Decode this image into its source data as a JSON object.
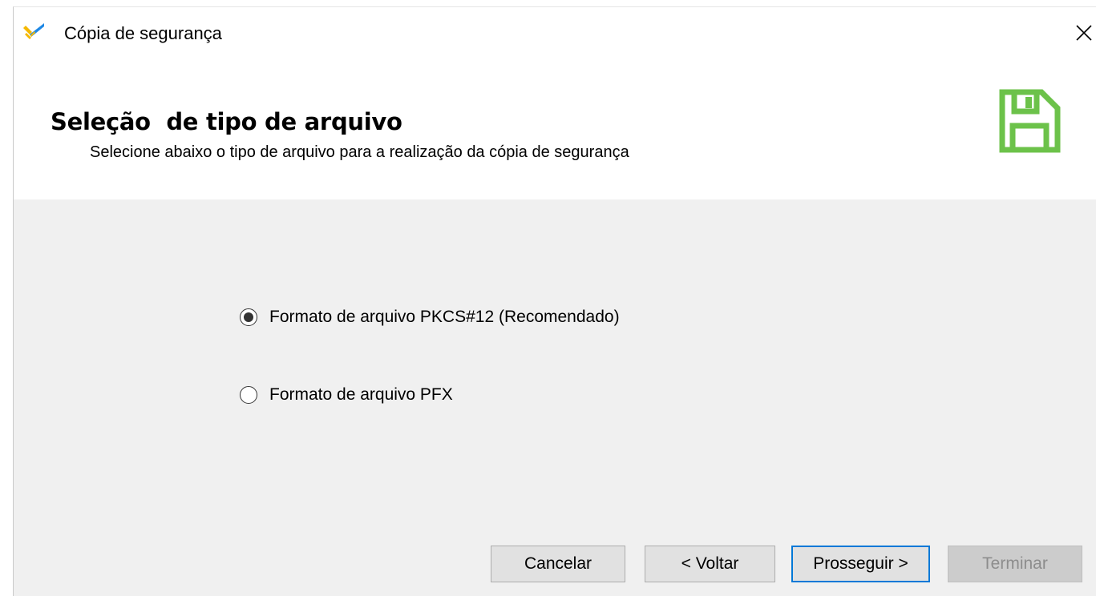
{
  "window": {
    "title": "Cópia de segurança",
    "close_glyph": "✕"
  },
  "header": {
    "title": "Seleção  de tipo de arquivo",
    "subtitle": "Selecione abaixo o tipo de arquivo para a realização da cópia de segurança",
    "icon": "floppy-disk-save-icon",
    "icon_color": "#6cc24a"
  },
  "options": [
    {
      "label": "Formato de arquivo PKCS#12 (Recomendado)",
      "selected": true
    },
    {
      "label": "Formato de arquivo PFX",
      "selected": false
    }
  ],
  "buttons": {
    "cancel": "Cancelar",
    "back": "< Voltar",
    "next": "Prosseguir >",
    "finish": "Terminar"
  },
  "colors": {
    "accent_blue": "#0078d7",
    "app_icon_yellow": "#f5b800",
    "app_icon_blue": "#1e88e5"
  }
}
